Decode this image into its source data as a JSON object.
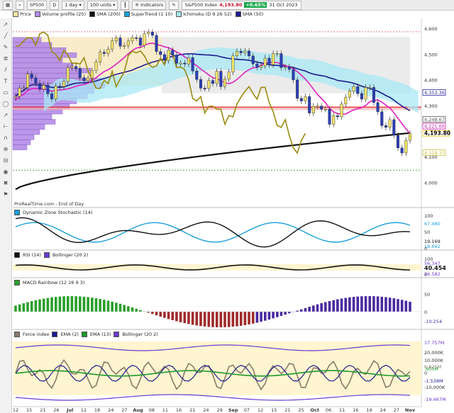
{
  "toolbar": {
    "symbol": "SP500",
    "period_letter": "D",
    "period": "1 day",
    "units": "100 units",
    "indicators": "Indicators",
    "instrument": "S&P500 Index",
    "price": "4,193.80",
    "change": "+0.65%",
    "date": "31 Oct 2023"
  },
  "legend": [
    "Price",
    "Volume profile (25)",
    "SMA (200)",
    "SuperTrend (1 10)",
    "Ichimoku (D 9 26 52)",
    "SMA (50)"
  ],
  "colors": {
    "sma200": "#111111",
    "sma50": "#1c1c8c",
    "supertrend_up": "#1aa0d8",
    "supertrend_dn": "#e020c0",
    "ichimoku_chikou": "#9a8a10",
    "cloud_up": "#a8e8f4",
    "cloud_dn": "#d0f0c8",
    "vp": "#b48ce8",
    "vp_zone": "#f4dca0"
  },
  "main_chart": {
    "source_label": "ProRealTime.com - End of Day",
    "right_ticks": [
      "4,600",
      "4,500",
      "4,400",
      "4,300",
      "4,200",
      "4,100",
      "4,000"
    ],
    "price_tags": [
      "4,353.36",
      "4,248.67",
      "4,221.66",
      "4,193.80",
      "4,118.37"
    ],
    "x_labels": [
      "12",
      "15",
      "21",
      "26",
      "Jul",
      "12",
      "18",
      "24",
      "27",
      "Aug",
      "08",
      "11",
      "16",
      "21",
      "24",
      "29",
      "Sep",
      "07",
      "12",
      "15",
      "21",
      "25",
      "Oct",
      "06",
      "11",
      "16",
      "19",
      "24",
      "27",
      "Nov"
    ]
  },
  "stoch": {
    "label": "Dynamic Zone Stochastic (14)",
    "ticks": [
      "100",
      "50",
      "0"
    ],
    "tags": [
      "67.480",
      "19.169",
      "18.692"
    ]
  },
  "rsi": {
    "legends": [
      "RSI (14)",
      "Bollinger (20 2)"
    ],
    "ticks": [
      "100",
      "0"
    ],
    "tags": [
      "56.347",
      "40.454",
      "26.582"
    ]
  },
  "macd": {
    "label": "MACD Rainbow (12 26 9 3)",
    "ticks": [
      "50",
      "0"
    ],
    "tags": [
      "-10.254"
    ]
  },
  "force": {
    "legends": [
      "Force index",
      "EMA (2)",
      "EMA (13)",
      "Bollinger (20 2)"
    ],
    "ticks": [
      "20,000K",
      "10,000K",
      "0",
      "-10,000K"
    ],
    "tags": [
      "17.757M",
      "6.825M",
      ".605M",
      "-1.538M",
      "-19.467M"
    ]
  },
  "chart_data": {
    "type": "candlestick",
    "title": "S&P500 Index",
    "ylim": [
      3940,
      4620
    ],
    "dates": [
      "12",
      "13",
      "14",
      "15",
      "16",
      "20",
      "21",
      "22",
      "23",
      "26",
      "27",
      "28",
      "29",
      "30",
      "Jul",
      "05",
      "06",
      "07",
      "10",
      "11",
      "12",
      "13",
      "14",
      "17",
      "18",
      "19",
      "20",
      "21",
      "24",
      "25",
      "26",
      "27",
      "28",
      "31",
      "Aug",
      "02",
      "03",
      "04",
      "07",
      "08",
      "09",
      "10",
      "11",
      "14",
      "15",
      "16",
      "17",
      "18",
      "21",
      "22",
      "23",
      "24",
      "25",
      "28",
      "29",
      "30",
      "31",
      "Sep",
      "05",
      "06",
      "07",
      "08",
      "11",
      "12",
      "13",
      "14",
      "15",
      "18",
      "19",
      "20",
      "21",
      "22",
      "25",
      "26",
      "27",
      "28",
      "29",
      "Oct",
      "03",
      "04",
      "05",
      "06",
      "09",
      "10",
      "11",
      "12",
      "13",
      "16",
      "17",
      "18",
      "19",
      "20",
      "23",
      "24",
      "25",
      "26",
      "27",
      "30",
      "31"
    ],
    "close": [
      4338,
      4370,
      4372,
      4425,
      4410,
      4389,
      4366,
      4382,
      4348,
      4328,
      4378,
      4376,
      4396,
      4450,
      4455,
      4446,
      4411,
      4399,
      4410,
      4439,
      4472,
      4510,
      4505,
      4522,
      4555,
      4566,
      4534,
      4536,
      4554,
      4567,
      4566,
      4537,
      4582,
      4589,
      4576,
      4513,
      4501,
      4478,
      4518,
      4499,
      4467,
      4468,
      4464,
      4489,
      4437,
      4404,
      4370,
      4369,
      4400,
      4388,
      4436,
      4376,
      4406,
      4433,
      4497,
      4514,
      4508,
      4515,
      4496,
      4465,
      4451,
      4457,
      4487,
      4461,
      4505,
      4505,
      4450,
      4453,
      4443,
      4402,
      4330,
      4320,
      4337,
      4273,
      4299,
      4300,
      4288,
      4288,
      4229,
      4263,
      4258,
      4308,
      4335,
      4358,
      4376,
      4349,
      4327,
      4373,
      4373,
      4314,
      4278,
      4224,
      4217,
      4247,
      4186,
      4137,
      4117,
      4166,
      4194
    ],
    "sma50_end": 4353.36,
    "supertrend_end": 4221.66,
    "sma200_end": 4193.8,
    "stoch_end": 18.692,
    "rsi_end": 40.454,
    "macd_end": -10.254
  }
}
